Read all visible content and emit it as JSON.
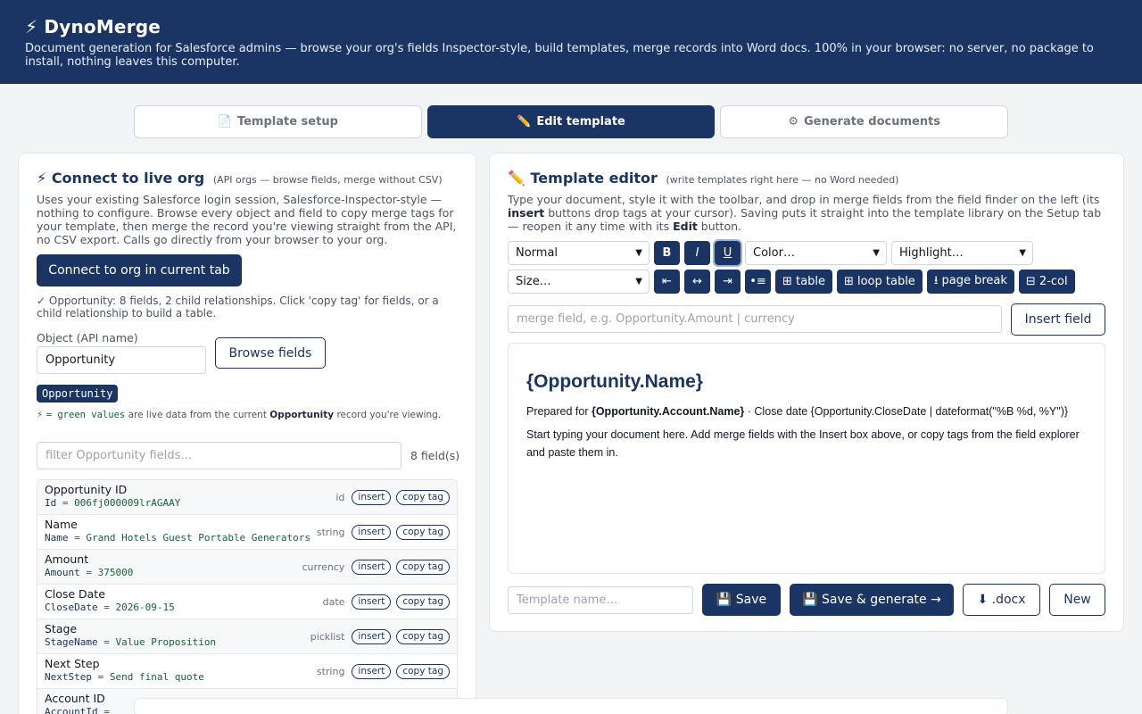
{
  "app": {
    "title": "⚡ DynoMerge",
    "subtitle": "Document generation for Salesforce admins — browse your org's fields Inspector-style, build templates, merge records into Word docs. 100% in your browser: no server, no package to install, nothing leaves this computer."
  },
  "steps": [
    {
      "icon": "📄",
      "label": "Template setup",
      "active": false
    },
    {
      "icon": "✏️",
      "label": "Edit template",
      "active": true
    },
    {
      "icon": "⚙",
      "label": "Generate documents",
      "active": false
    }
  ],
  "connect": {
    "icon": "⚡",
    "title": "Connect to live org",
    "title_sub": "(API orgs — browse fields, merge without CSV)",
    "description": "Uses your existing Salesforce login session, Salesforce-Inspector-style — nothing to configure. Browse every object and field to copy merge tags for your template, then merge the record you're viewing straight from the API, no CSV export. Calls go directly from your browser to your org.",
    "connect_button": "Connect to org in current tab",
    "status": "✓ Opportunity: 8 fields, 2 child relationships. Click 'copy tag' for fields, or a child relationship to build a table.",
    "object_label": "Object (API name)",
    "object_value": "Opportunity",
    "browse_button": "Browse fields",
    "object_chip": "Opportunity",
    "legend_prefix": "⚡",
    "legend_mono": "= green values",
    "legend_mid": "are live data from the current",
    "legend_object": "Opportunity",
    "legend_suffix": "record you're viewing.",
    "filter_placeholder": "filter Opportunity fields…",
    "field_count": "8 field(s)",
    "insert_label": "insert",
    "copy_label": "copy tag",
    "fields": [
      {
        "label": "Opportunity ID",
        "api": "Id",
        "value": "006fj000009lrAGAAY",
        "type": "id"
      },
      {
        "label": "Name",
        "api": "Name",
        "value": "Grand Hotels Guest Portable Generators",
        "type": "string"
      },
      {
        "label": "Amount",
        "api": "Amount",
        "value": "375000",
        "type": "currency"
      },
      {
        "label": "Close Date",
        "api": "CloseDate",
        "value": "2026-09-15",
        "type": "date"
      },
      {
        "label": "Stage",
        "api": "StageName",
        "value": "Value Proposition",
        "type": "picklist"
      },
      {
        "label": "Next Step",
        "api": "NextStep",
        "value": "Send final quote",
        "type": "string"
      },
      {
        "label": "Account ID",
        "api": "AccountId",
        "value": "",
        "type": ""
      }
    ]
  },
  "editor": {
    "icon": "✏️",
    "title": "Template editor",
    "title_sub": "(write templates right here — no Word needed)",
    "desc_1": "Type your document, style it with the toolbar, and drop in merge fields from the field finder on the left (its ",
    "desc_insert": "insert",
    "desc_2": " buttons drop tags at your cursor). Saving puts it straight into the template library on the Setup tab — reopen it any time with its ",
    "desc_edit": "Edit",
    "desc_3": " button.",
    "toolbar": {
      "style_select": "Normal",
      "bold": "B",
      "italic": "I",
      "underline": "U",
      "color_select": "Color…",
      "highlight_select": "Highlight…",
      "size_select": "Size…",
      "align_left": "⇤",
      "align_center": "↔",
      "align_right": "⇥",
      "bullets": "•≡",
      "table": "⊞ table",
      "loop_table": "⊞ loop table",
      "page_break": "⭳ page break",
      "two_col": "⊟ 2-col"
    },
    "merge_placeholder": "merge field, e.g. Opportunity.Amount | currency",
    "insert_field_button": "Insert field",
    "doc": {
      "heading": "{Opportunity.Name}",
      "prepared_prefix": "Prepared for ",
      "prepared_tag": "{Opportunity.Account.Name}",
      "prepared_suffix": " · Close date {Opportunity.CloseDate | dateformat(\"%B %d, %Y\")}",
      "body": "Start typing your document here. Add merge fields with the Insert box above, or copy tags from the field explorer and paste them in."
    },
    "template_name_placeholder": "Template name…",
    "save_button": "💾 Save",
    "save_generate_button": "💾 Save & generate →",
    "docx_button": "⬇ .docx",
    "new_button": "New"
  }
}
